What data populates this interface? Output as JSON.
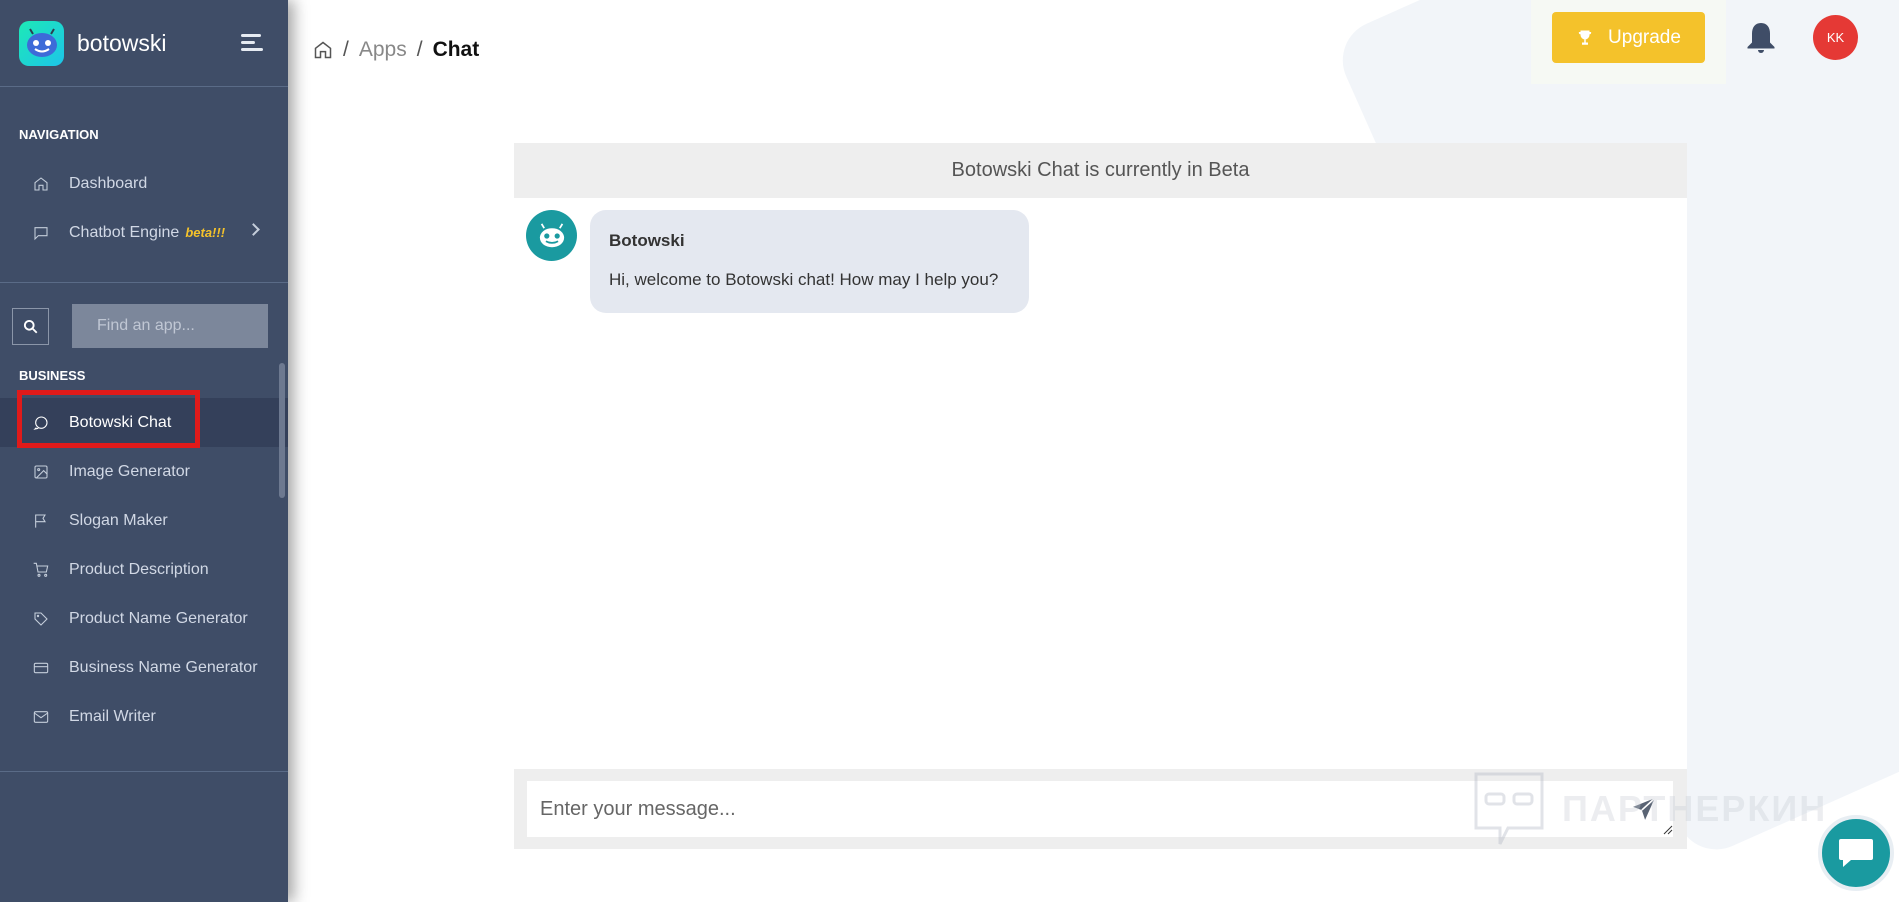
{
  "brand": {
    "name": "botowski"
  },
  "sidebar": {
    "nav_caption": "NAVIGATION",
    "nav_items": [
      {
        "label": "Dashboard",
        "icon": "home-icon"
      },
      {
        "label": "Chatbot Engine",
        "badge": "beta!!!",
        "icon": "message-square-icon"
      }
    ],
    "search": {
      "placeholder": "Find an app..."
    },
    "business_caption": "BUSINESS",
    "business_items": [
      {
        "label": "Botowski Chat",
        "icon": "message-circle-icon",
        "active": true
      },
      {
        "label": "Image Generator",
        "icon": "image-icon"
      },
      {
        "label": "Slogan Maker",
        "icon": "flag-icon"
      },
      {
        "label": "Product Description",
        "icon": "shopping-cart-icon"
      },
      {
        "label": "Product Name Generator",
        "icon": "tag-icon"
      },
      {
        "label": "Business Name Generator",
        "icon": "credit-card-icon"
      },
      {
        "label": "Email Writer",
        "icon": "mail-icon"
      }
    ]
  },
  "breadcrumb": {
    "items": [
      "Apps",
      "Chat"
    ]
  },
  "header": {
    "upgrade_label": "Upgrade",
    "avatar_initials": "KK"
  },
  "chat": {
    "beta_notice": "Botowski Chat is currently in Beta",
    "messages": [
      {
        "sender": "Botowski",
        "text": "Hi, welcome to Botowski chat! How may I help you?"
      }
    ],
    "input_placeholder": "Enter your message..."
  },
  "watermark": "ПАРТНЕРКИН",
  "colors": {
    "sidebar": "#3f4d67",
    "accent_yellow": "#f4c22b",
    "bot_teal": "#1a9aa0",
    "avatar_red": "#e53935",
    "highlight_red": "#e01a1a"
  }
}
